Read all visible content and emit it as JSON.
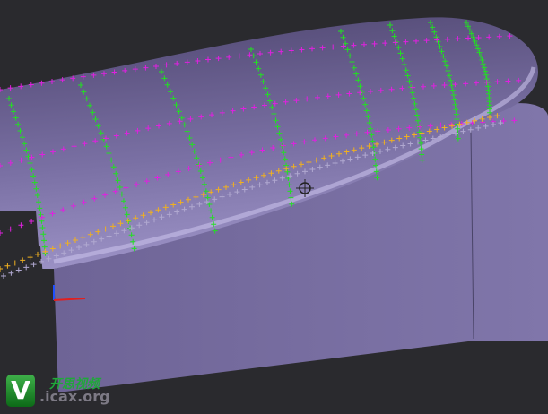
{
  "viewport": {
    "title": "3D model viewport",
    "background": "#2a2a2e"
  },
  "watermark": {
    "logo_letter": "V",
    "chinese_text": "开思视频",
    "url": ".icax.org"
  },
  "colors": {
    "top_surface": "#6a6090",
    "front_face": "#7a6fa3",
    "point_green": "#22e022",
    "point_magenta": "#e020e0",
    "point_orange": "#f0b020",
    "point_grey": "#b0a8d0"
  }
}
